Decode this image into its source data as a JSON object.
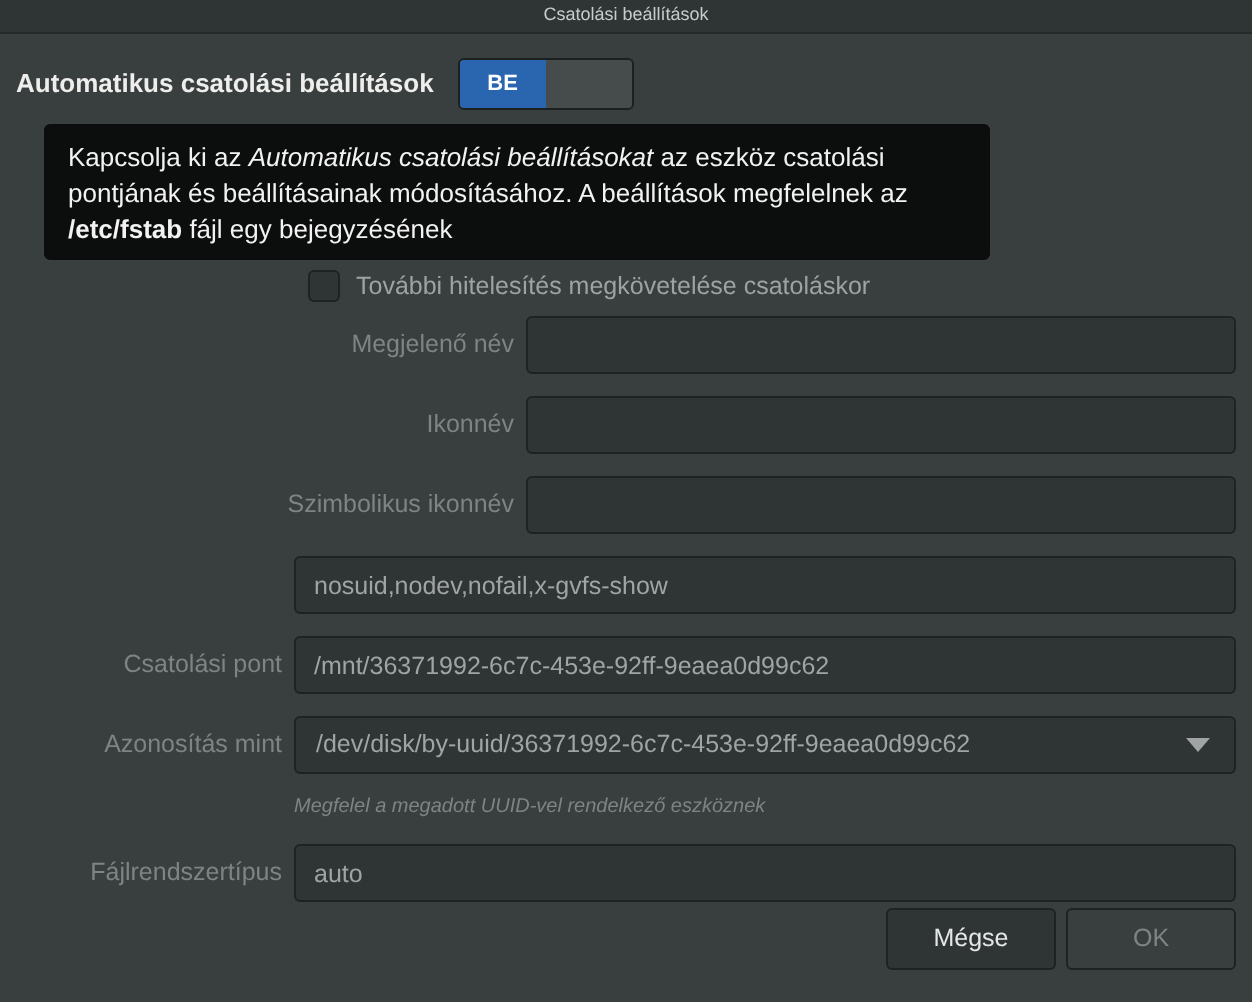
{
  "window": {
    "title": "Csatolási beállítások"
  },
  "automount": {
    "label": "Automatikus csatolási beállítások",
    "toggle_label": "BE",
    "on": true
  },
  "tooltip": {
    "text": "Kapcsolja ki az *Automatikus csatolási beállításokat* az eszköz csatolási pontjának és beállításainak módosításához. A beállítások megfelelnek az **/etc/fstab** fájl egy bejegyzésének"
  },
  "options": [
    {
      "label": "További hitelesítés megkövetelése csatoláskor",
      "checked": false
    }
  ],
  "identity_fields": [
    {
      "label": "Megjelenő név"
    },
    {
      "label": "Ikonnév"
    },
    {
      "label": "Szimbolikus ikonnév"
    }
  ],
  "mount_fields": [
    {
      "kind": "text",
      "value": "nosuid,nodev,nofail,x-gvfs-show"
    },
    {
      "kind": "text",
      "label": "Csatolási pont",
      "value": "/mnt/36371992-6c7c-453e-92ff-9eaea0d99c62"
    },
    {
      "kind": "combo",
      "label": "Azonosítás mint",
      "value": "/dev/disk/by-uuid/36371992-6c7c-453e-92ff-9eaea0d99c62",
      "hint": "Megfelel a megadott UUID-vel rendelkező eszköznek"
    },
    {
      "kind": "text",
      "label": "Fájlrendszertípus",
      "value": "auto"
    }
  ],
  "buttons": [
    {
      "label": "Mégse",
      "disabled": false
    },
    {
      "label": "OK",
      "disabled": true
    }
  ]
}
